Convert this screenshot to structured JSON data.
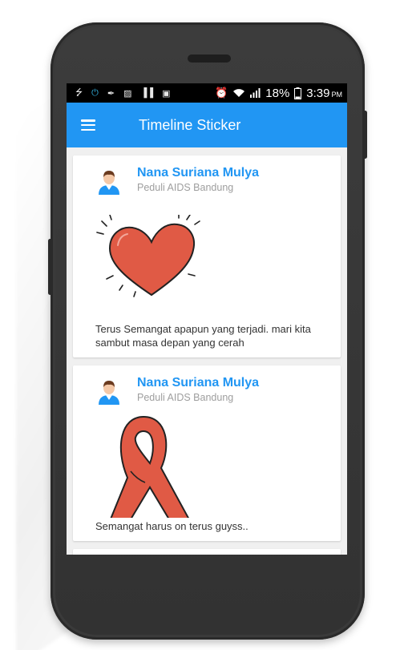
{
  "statusbar": {
    "icons": [
      "usb-icon",
      "power-icon",
      "bolt-icon",
      "image-icon",
      "barcode-icon",
      "briefcase-icon"
    ],
    "right_icons": [
      "alarm-icon",
      "wifi-icon",
      "signal-icon"
    ],
    "battery": "18%",
    "time": "3:39",
    "ampm": "PM"
  },
  "appbar": {
    "title": "Timeline Sticker"
  },
  "posts": [
    {
      "author": "Nana Suriana Mulya",
      "organization": "Peduli AIDS Bandung",
      "sticker": "heart-sticker",
      "caption": "Terus Semangat apapun yang terjadi. mari kita sambut masa depan yang cerah"
    },
    {
      "author": "Nana Suriana Mulya",
      "organization": "Peduli AIDS Bandung",
      "sticker": "red-ribbon-sticker",
      "caption": "Semangat harus on terus guyss.."
    }
  ],
  "colors": {
    "primary": "#2196f3",
    "heart": "#e05a45",
    "ribbon": "#e05a45"
  }
}
